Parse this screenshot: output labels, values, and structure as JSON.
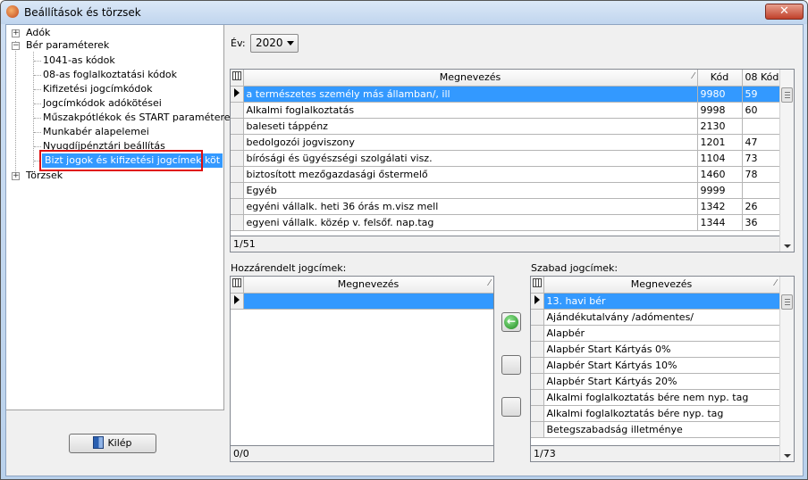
{
  "window": {
    "title": "Beállítások és törzsek",
    "close_symbol": "✕"
  },
  "tree": {
    "adok": {
      "label": "Adók",
      "expander": "+"
    },
    "ber": {
      "label": "Bér paraméterek",
      "expander": "−"
    },
    "children": [
      "1041-as kódok",
      "08-as foglalkoztatási kódok",
      "Kifizetési jogcímkódok",
      "Jogcímkódok adókötései",
      "Műszakpótlékok és START paraméterek",
      "Munkabér alapelemei",
      "Nyugdíjpénztári beállítás",
      "Bizt jogok és kifizetési jogcímek köt"
    ],
    "torzsek": {
      "label": "Törzsek",
      "expander": "+"
    }
  },
  "exit_button": {
    "label": "Kilép"
  },
  "year": {
    "label": "Év:",
    "value": "2020"
  },
  "main_grid": {
    "headers": [
      "Megnevezés",
      "Kód",
      "08 Kód"
    ],
    "rows": [
      [
        "a természetes személy más államban/, ill",
        "9980",
        "59"
      ],
      [
        "Alkalmi foglalkoztatás",
        "9998",
        "60"
      ],
      [
        "baleseti táppénz",
        "2130",
        ""
      ],
      [
        "bedolgozói jogviszony",
        "1201",
        "47"
      ],
      [
        "bírósági és ügyészségi szolgálati visz.",
        "1104",
        "73"
      ],
      [
        "biztosított mezőgazdasági őstermelő",
        "1460",
        "78"
      ],
      [
        "Egyéb",
        "9999",
        ""
      ],
      [
        "egyéni vállalk. heti 36 órás m.visz mell",
        "1342",
        "26"
      ],
      [
        "egyeni vállalk. közép v. felsőf. nap.tag",
        "1344",
        "36"
      ]
    ],
    "status": "1/51"
  },
  "assigned": {
    "label": "Hozzárendelt jogcímek:",
    "header": "Megnevezés",
    "status": "0/0"
  },
  "free": {
    "label": "Szabad jogcímek:",
    "header": "Megnevezés",
    "rows": [
      "13. havi bér",
      "Ajándékutalvány /adómentes/",
      "Alapbér",
      "Alapbér Start Kártyás 0%",
      "Alapbér Start Kártyás 10%",
      "Alapbér Start Kártyás 20%",
      "Alkalmi foglalkoztatás bére nem nyp. tag",
      "Alkalmi foglalkoztatás bére nyp. tag",
      "Betegszabadság illetménye"
    ],
    "status": "1/73"
  },
  "add_button": {
    "symbol": "←"
  },
  "sort_mark": "⁄"
}
